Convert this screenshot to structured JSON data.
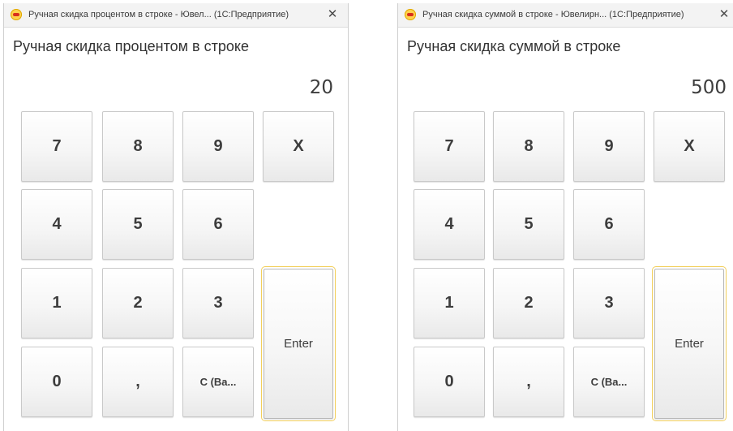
{
  "windows": [
    {
      "title": "Ручная скидка процентом в строке - Ювел...  (1С:Предприятие)",
      "close_glyph": "✕",
      "heading": "Ручная скидка процентом в строке",
      "display_value": "20",
      "keys": {
        "k7": "7",
        "k8": "8",
        "k9": "9",
        "clear_x": "X",
        "k4": "4",
        "k5": "5",
        "k6": "6",
        "k1": "1",
        "k2": "2",
        "k3": "3",
        "k0": "0",
        "comma": ",",
        "backspace": "C (Ba...",
        "enter": "Enter"
      }
    },
    {
      "title": "Ручная скидка суммой в строке - Ювелирн...  (1С:Предприятие)",
      "close_glyph": "✕",
      "heading": "Ручная скидка суммой в строке",
      "display_value": "500",
      "keys": {
        "k7": "7",
        "k8": "8",
        "k9": "9",
        "clear_x": "X",
        "k4": "4",
        "k5": "5",
        "k6": "6",
        "k1": "1",
        "k2": "2",
        "k3": "3",
        "k0": "0",
        "comma": ",",
        "backspace": "C (Ba...",
        "enter": "Enter"
      }
    }
  ],
  "icons": {
    "app": "1c-enterprise-icon",
    "close": "close-icon"
  },
  "colors": {
    "enter_highlight": "#f2cf5b",
    "app_icon_yellow": "#ffd24d",
    "app_icon_red": "#d8301c"
  }
}
